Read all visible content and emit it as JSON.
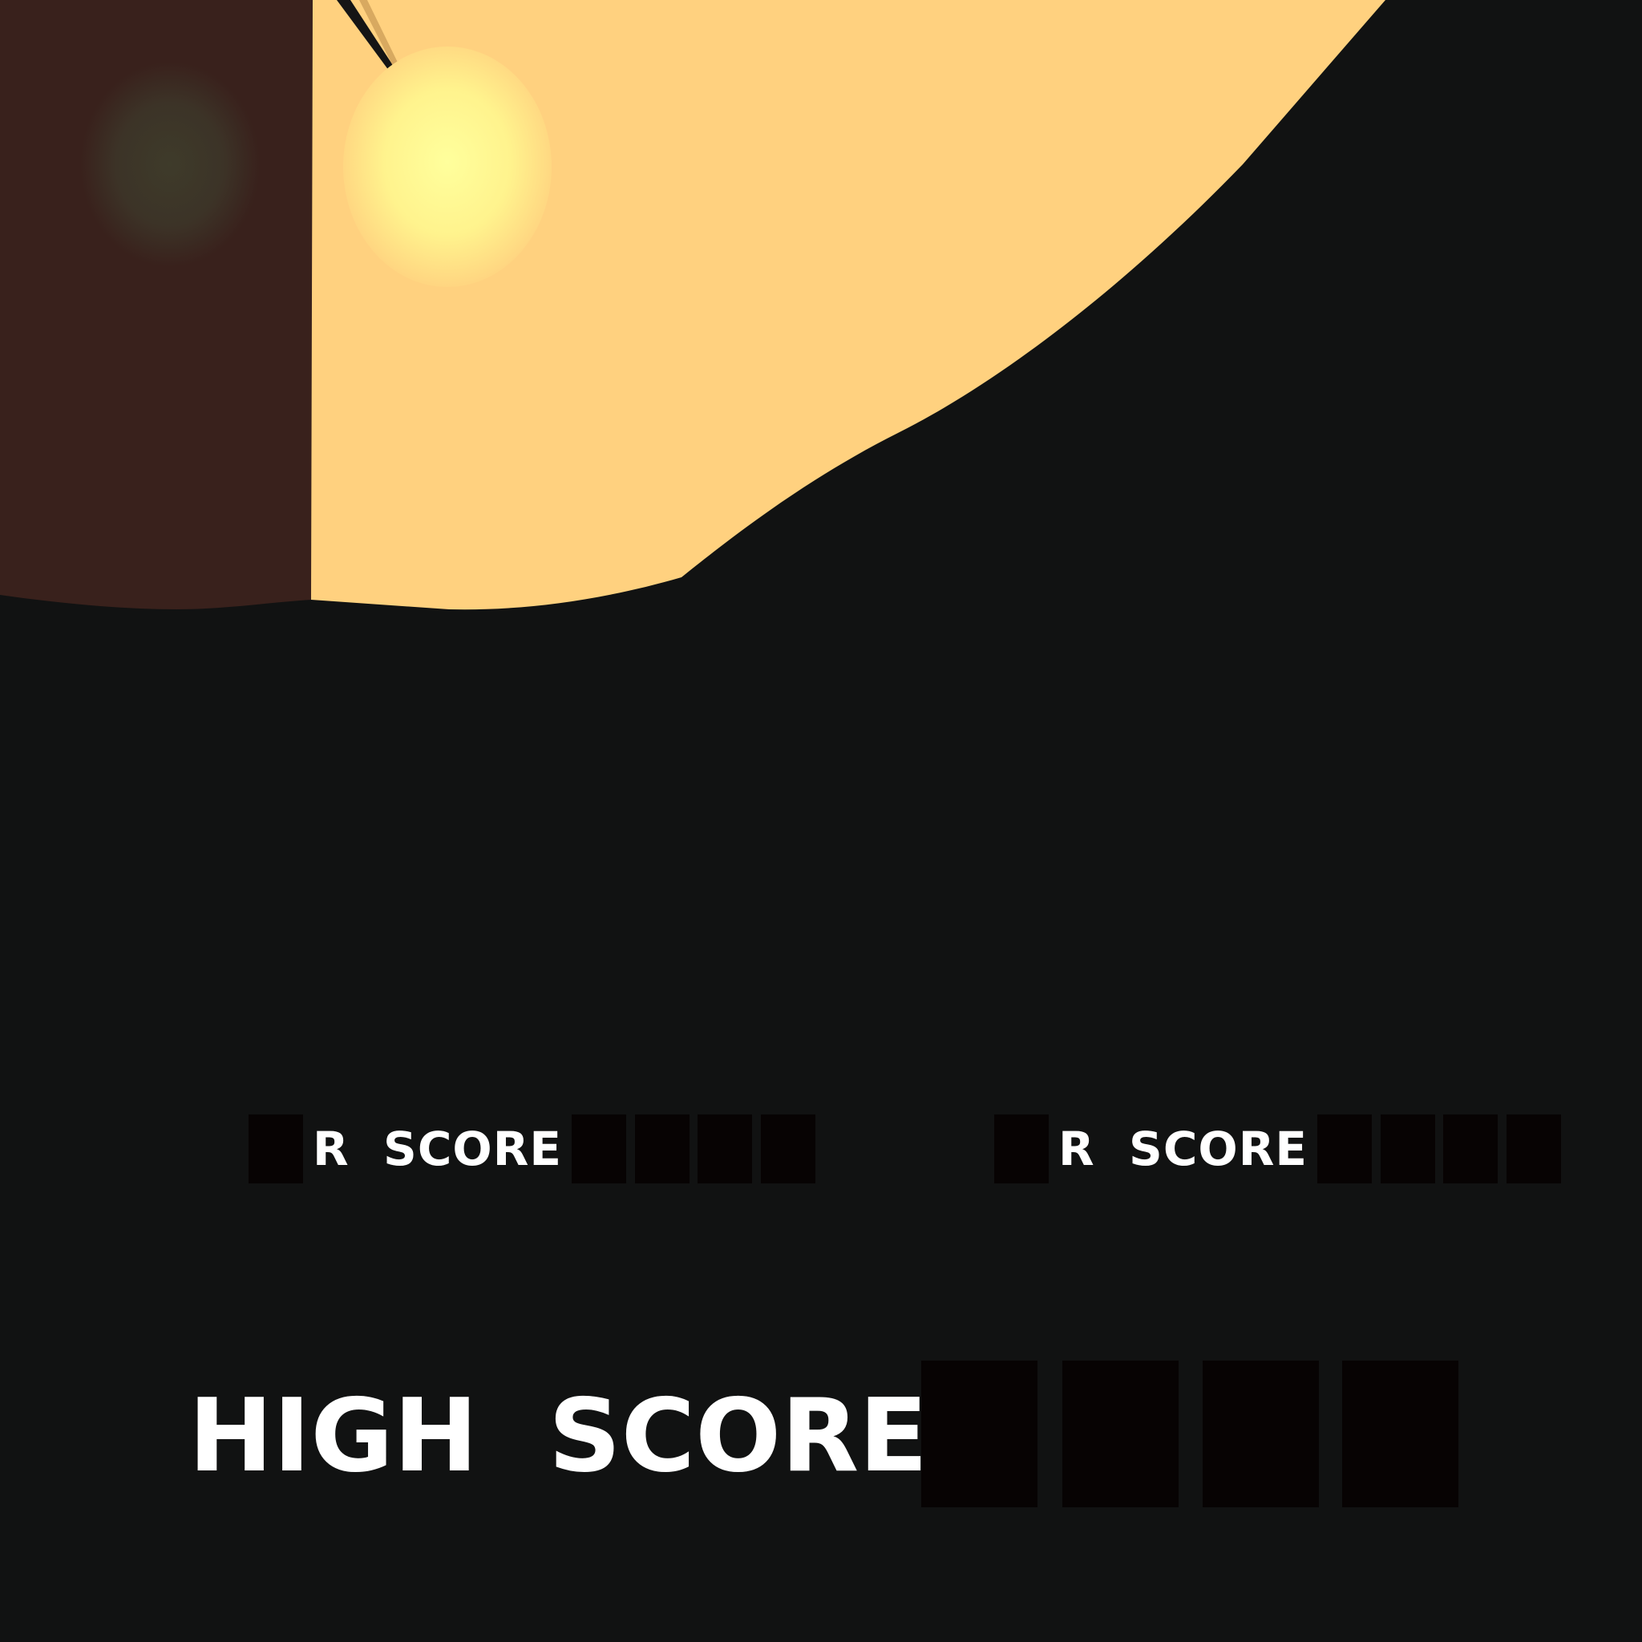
{
  "scene": {
    "colors": {
      "background": "#111212",
      "light_glow": "#ffd17f",
      "wall": "#39211c",
      "lamp_bulb": "#ffff99",
      "wall_window": "#3e3b2a",
      "blank_digit": "#070303",
      "text": "#ffffff"
    },
    "objects": [
      "hanging-lamp",
      "lamp-bulb",
      "wall-panel",
      "light-cone"
    ]
  },
  "hud": {
    "player1": {
      "label": "R  SCORE",
      "leading_boxes": 1,
      "digit_boxes": 4
    },
    "player2": {
      "label": "R  SCORE",
      "leading_boxes": 1,
      "digit_boxes": 4
    },
    "high_score": {
      "label": "HIGH  SCORE",
      "digit_boxes": 4
    }
  }
}
